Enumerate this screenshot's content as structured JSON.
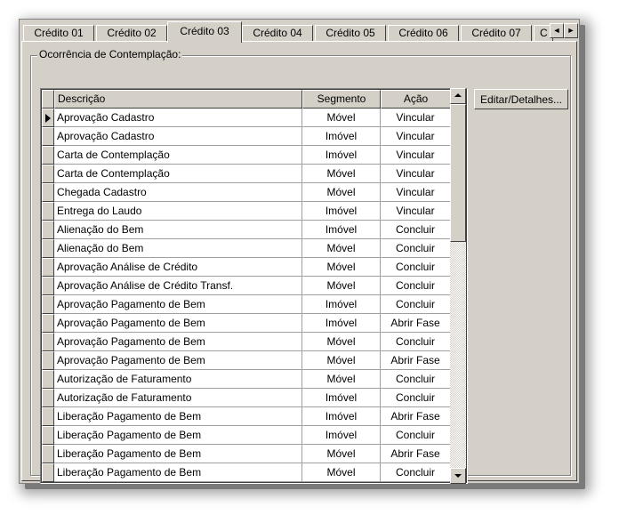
{
  "tabs": [
    {
      "label": "Crédito 01"
    },
    {
      "label": "Crédito 02"
    },
    {
      "label": "Crédito 03",
      "active": true
    },
    {
      "label": "Crédito 04"
    },
    {
      "label": "Crédito 05"
    },
    {
      "label": "Crédito 06"
    },
    {
      "label": "Crédito 07"
    },
    {
      "label": "C"
    }
  ],
  "tab_arrows": {
    "left": "◄",
    "right": "►"
  },
  "group": {
    "title": "Ocorrência de Contemplação:"
  },
  "grid": {
    "columns": [
      "Descrição",
      "Segmento",
      "Ação"
    ],
    "rows": [
      {
        "descricao": "Aprovação Cadastro",
        "segmento": "Móvel",
        "acao": "Vincular",
        "current": true
      },
      {
        "descricao": "Aprovação Cadastro",
        "segmento": "Imóvel",
        "acao": "Vincular"
      },
      {
        "descricao": "Carta de Contemplação",
        "segmento": "Imóvel",
        "acao": "Vincular"
      },
      {
        "descricao": "Carta de Contemplação",
        "segmento": "Móvel",
        "acao": "Vincular"
      },
      {
        "descricao": "Chegada Cadastro",
        "segmento": "Móvel",
        "acao": "Vincular"
      },
      {
        "descricao": "Entrega do Laudo",
        "segmento": "Imóvel",
        "acao": "Vincular"
      },
      {
        "descricao": "Alienação do Bem",
        "segmento": "Imóvel",
        "acao": "Concluir"
      },
      {
        "descricao": "Alienação do Bem",
        "segmento": "Móvel",
        "acao": "Concluir"
      },
      {
        "descricao": "Aprovação Análise de Crédito",
        "segmento": "Móvel",
        "acao": "Concluir"
      },
      {
        "descricao": "Aprovação Análise de Crédito Transf.",
        "segmento": "Móvel",
        "acao": "Concluir"
      },
      {
        "descricao": "Aprovação Pagamento de Bem",
        "segmento": "Imóvel",
        "acao": "Concluir"
      },
      {
        "descricao": "Aprovação Pagamento de Bem",
        "segmento": "Imóvel",
        "acao": "Abrir Fase"
      },
      {
        "descricao": "Aprovação Pagamento de Bem",
        "segmento": "Móvel",
        "acao": "Concluir"
      },
      {
        "descricao": "Aprovação Pagamento de Bem",
        "segmento": "Móvel",
        "acao": "Abrir Fase"
      },
      {
        "descricao": "Autorização de Faturamento",
        "segmento": "Móvel",
        "acao": "Concluir"
      },
      {
        "descricao": "Autorização de Faturamento",
        "segmento": "Imóvel",
        "acao": "Concluir"
      },
      {
        "descricao": "Liberação Pagamento de Bem",
        "segmento": "Imóvel",
        "acao": "Abrir Fase"
      },
      {
        "descricao": "Liberação Pagamento de Bem",
        "segmento": "Imóvel",
        "acao": "Concluir"
      },
      {
        "descricao": "Liberação Pagamento de Bem",
        "segmento": "Móvel",
        "acao": "Abrir Fase"
      },
      {
        "descricao": "Liberação Pagamento de Bem",
        "segmento": "Móvel",
        "acao": "Concluir"
      }
    ]
  },
  "buttons": {
    "edit_label": "Editar/Detalhes..."
  }
}
